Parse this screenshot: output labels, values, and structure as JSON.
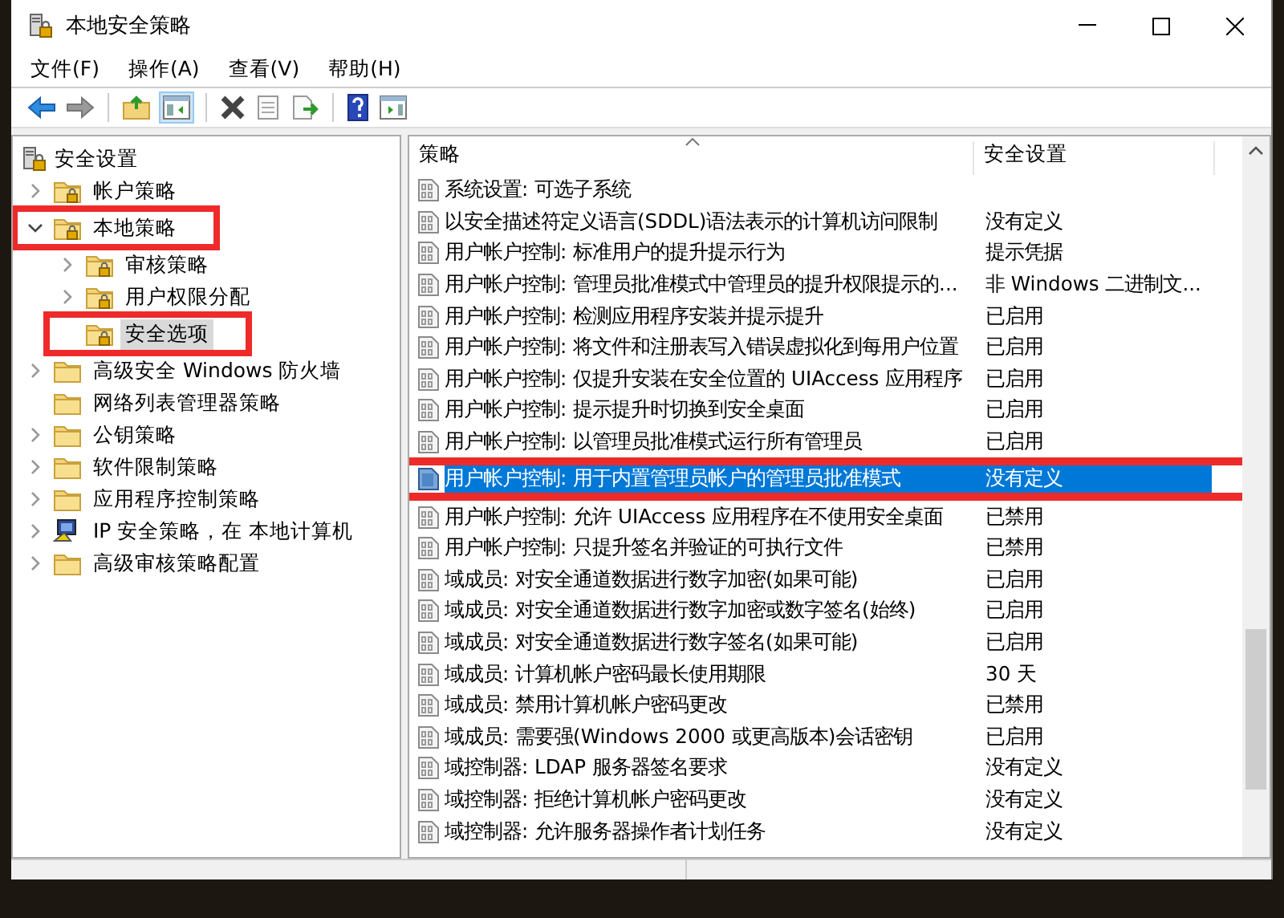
{
  "window": {
    "title": "本地安全策略"
  },
  "menu": [
    "文件(F)",
    "操作(A)",
    "查看(V)",
    "帮助(H)"
  ],
  "tree": {
    "label": "安全设置",
    "kind": "server",
    "children": [
      {
        "label": "帐户策略",
        "kind": "locked_folder",
        "expanded": false,
        "selected": false,
        "marked": false
      },
      {
        "label": "本地策略",
        "kind": "locked_folder",
        "expanded": true,
        "selected": false,
        "marked": true,
        "children": [
          {
            "label": "审核策略",
            "kind": "locked_folder",
            "expanded": false,
            "selected": false,
            "marked": false
          },
          {
            "label": "用户权限分配",
            "kind": "locked_folder",
            "expanded": false,
            "selected": false,
            "marked": false
          },
          {
            "label": "安全选项",
            "kind": "locked_folder",
            "selected": true,
            "marked": true
          }
        ]
      },
      {
        "label": "高级安全 Windows 防火墙",
        "kind": "folder",
        "expanded": false,
        "selected": false,
        "marked": false
      },
      {
        "label": "网络列表管理器策略",
        "kind": "folder",
        "selected": false,
        "marked": false
      },
      {
        "label": "公钥策略",
        "kind": "folder",
        "expanded": false,
        "selected": false,
        "marked": false
      },
      {
        "label": "软件限制策略",
        "kind": "folder",
        "expanded": false,
        "selected": false,
        "marked": false
      },
      {
        "label": "应用程序控制策略",
        "kind": "folder",
        "expanded": false,
        "selected": false,
        "marked": false
      },
      {
        "label": "IP 安全策略，在 本地计算机",
        "kind": "ip",
        "expanded": false,
        "selected": false,
        "marked": false
      },
      {
        "label": "高级审核策略配置",
        "kind": "folder",
        "expanded": false,
        "selected": false,
        "marked": false
      }
    ]
  },
  "table": {
    "columns": [
      "策略",
      "安全设置"
    ],
    "rows": [
      {
        "policy": "系统设置: 可选子系统",
        "selected": false,
        "marked": false
      },
      {
        "policy": "以安全描述符定义语言(SDDL)语法表示的计算机访问限制",
        "setting": "没有定义",
        "selected": false,
        "marked": false
      },
      {
        "policy": "用户帐户控制: 标准用户的提升提示行为",
        "setting": "提示凭据",
        "selected": false,
        "marked": false
      },
      {
        "policy": "用户帐户控制: 管理员批准模式中管理员的提升权限提示的...",
        "setting": "非 Windows 二进制文...",
        "selected": false,
        "marked": false
      },
      {
        "policy": "用户帐户控制: 检测应用程序安装并提示提升",
        "setting": "已启用",
        "selected": false,
        "marked": false
      },
      {
        "policy": "用户帐户控制: 将文件和注册表写入错误虚拟化到每用户位置",
        "setting": "已启用",
        "selected": false,
        "marked": false
      },
      {
        "policy": "用户帐户控制: 仅提升安装在安全位置的 UIAccess 应用程序",
        "setting": "已启用",
        "selected": false,
        "marked": false
      },
      {
        "policy": "用户帐户控制: 提示提升时切换到安全桌面",
        "setting": "已启用",
        "selected": false,
        "marked": false
      },
      {
        "policy": "用户帐户控制: 以管理员批准模式运行所有管理员",
        "setting": "已启用",
        "selected": false,
        "marked": false
      },
      {
        "policy": "用户帐户控制: 用于内置管理员帐户的管理员批准模式",
        "setting": "没有定义",
        "selected": true,
        "marked": true
      },
      {
        "policy": "用户帐户控制: 允许 UIAccess 应用程序在不使用安全桌面",
        "setting": "已禁用",
        "selected": false,
        "marked": false
      },
      {
        "policy": "用户帐户控制: 只提升签名并验证的可执行文件",
        "setting": "已禁用",
        "selected": false,
        "marked": false
      },
      {
        "policy": "域成员: 对安全通道数据进行数字加密(如果可能)",
        "setting": "已启用",
        "selected": false,
        "marked": false
      },
      {
        "policy": "域成员: 对安全通道数据进行数字加密或数字签名(始终)",
        "setting": "已启用",
        "selected": false,
        "marked": false
      },
      {
        "policy": "域成员: 对安全通道数据进行数字签名(如果可能)",
        "setting": "已启用",
        "selected": false,
        "marked": false
      },
      {
        "policy": "域成员: 计算机帐户密码最长使用期限",
        "setting": "30 天",
        "selected": false,
        "marked": false
      },
      {
        "policy": "域成员: 禁用计算机帐户密码更改",
        "setting": "已禁用",
        "selected": false,
        "marked": false
      },
      {
        "policy": "域成员: 需要强(Windows 2000 或更高版本)会话密钥",
        "setting": "已启用",
        "selected": false,
        "marked": false
      },
      {
        "policy": "域控制器: LDAP 服务器签名要求",
        "setting": "没有定义",
        "selected": false,
        "marked": false
      },
      {
        "policy": "域控制器: 拒绝计算机帐户密码更改",
        "setting": "没有定义",
        "selected": false,
        "marked": false
      },
      {
        "policy": "域控制器: 允许服务器操作者计划任务",
        "setting": "没有定义",
        "selected": false,
        "marked": false
      }
    ]
  }
}
